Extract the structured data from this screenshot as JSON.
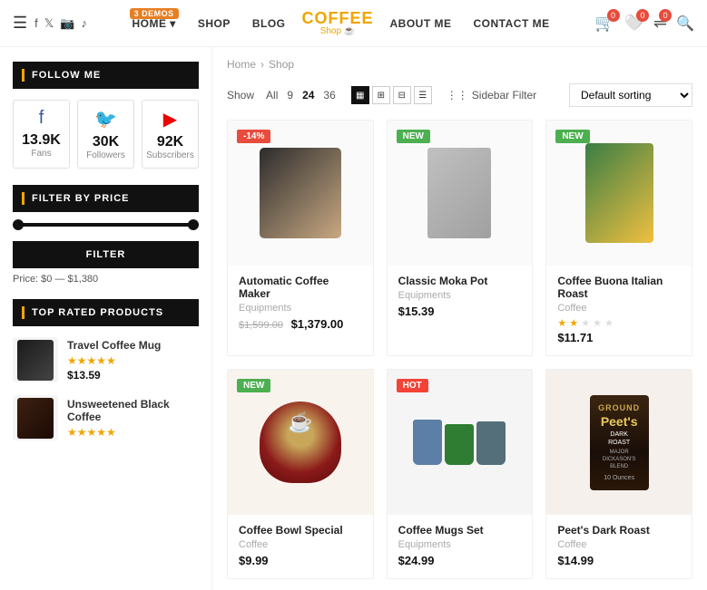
{
  "header": {
    "menu_icon": "☰",
    "demos_badge": "3 DEMOS",
    "nav_links": [
      {
        "id": "home",
        "label": "HOME",
        "has_dropdown": true
      },
      {
        "id": "shop",
        "label": "SHOP"
      },
      {
        "id": "blog",
        "label": "BLOG"
      }
    ],
    "logo": {
      "line1": "COFFEE",
      "line2": "Shop ☕"
    },
    "nav_links_right": [
      {
        "id": "about",
        "label": "ABOUT ME"
      },
      {
        "id": "contact",
        "label": "CONTACT ME"
      }
    ],
    "cart_count": "0",
    "wishlist_count": "0",
    "compare_count": "0"
  },
  "breadcrumb": {
    "home": "Home",
    "sep": "›",
    "current": "Shop"
  },
  "sidebar": {
    "follow_title": "FOLLOW ME",
    "follow_cards": [
      {
        "id": "facebook",
        "icon": "f",
        "count": "13.9K",
        "label": "Fans"
      },
      {
        "id": "twitter",
        "icon": "𝕏",
        "count": "30K",
        "label": "Followers"
      },
      {
        "id": "youtube",
        "icon": "▶",
        "count": "92K",
        "label": "Subscribers"
      }
    ],
    "filter_title": "FILTER BY PRICE",
    "filter_btn_label": "FILTER",
    "price_range": "Price: $0 — $1,380",
    "top_rated_title": "TOP RATED PRODUCTS",
    "top_rated": [
      {
        "name": "Travel Coffee Mug",
        "price": "$13.59",
        "stars": 5
      },
      {
        "name": "Unsweetened Black Coffee",
        "price": "",
        "stars": 5
      }
    ]
  },
  "shop": {
    "show_label": "Show",
    "show_options": [
      "All",
      "9",
      "24",
      "36"
    ],
    "active_show": "24",
    "sidebar_filter": "Sidebar Filter",
    "sort_default": "Default sorting",
    "products": [
      {
        "id": "auto-coffee-maker",
        "name": "Automatic Coffee Maker",
        "category": "Equipments",
        "old_price": "$1,599.00",
        "price": "$1,379.00",
        "badge": "-14%",
        "badge_type": "sale",
        "stars": 0,
        "img_type": "coffee-maker"
      },
      {
        "id": "classic-moka-pot",
        "name": "Classic Moka Pot",
        "category": "Equipments",
        "price": "$15.39",
        "badge": "NEW",
        "badge_type": "new",
        "stars": 0,
        "img_type": "moka"
      },
      {
        "id": "coffee-buona-italian-roast",
        "name": "Coffee Buona Italian Roast",
        "category": "Coffee",
        "price": "$11.71",
        "badge": "NEW",
        "badge_type": "new",
        "stars": 2.5,
        "img_type": "italian-roast"
      },
      {
        "id": "coffee-bowl",
        "name": "Coffee Bowl Special",
        "category": "Coffee",
        "price": "$9.99",
        "badge": "NEW",
        "badge_type": "new",
        "stars": 0,
        "img_type": "coffee-bowl"
      },
      {
        "id": "coffee-mugs-set",
        "name": "Coffee Mugs Set",
        "category": "Equipments",
        "price": "$24.99",
        "badge": "HOT",
        "badge_type": "hot",
        "stars": 0,
        "img_type": "mugs"
      },
      {
        "id": "peets-dark-roast",
        "name": "Peet's Dark Roast",
        "category": "Coffee",
        "price": "$14.99",
        "badge": "",
        "badge_type": "",
        "stars": 0,
        "img_type": "peets"
      }
    ]
  }
}
